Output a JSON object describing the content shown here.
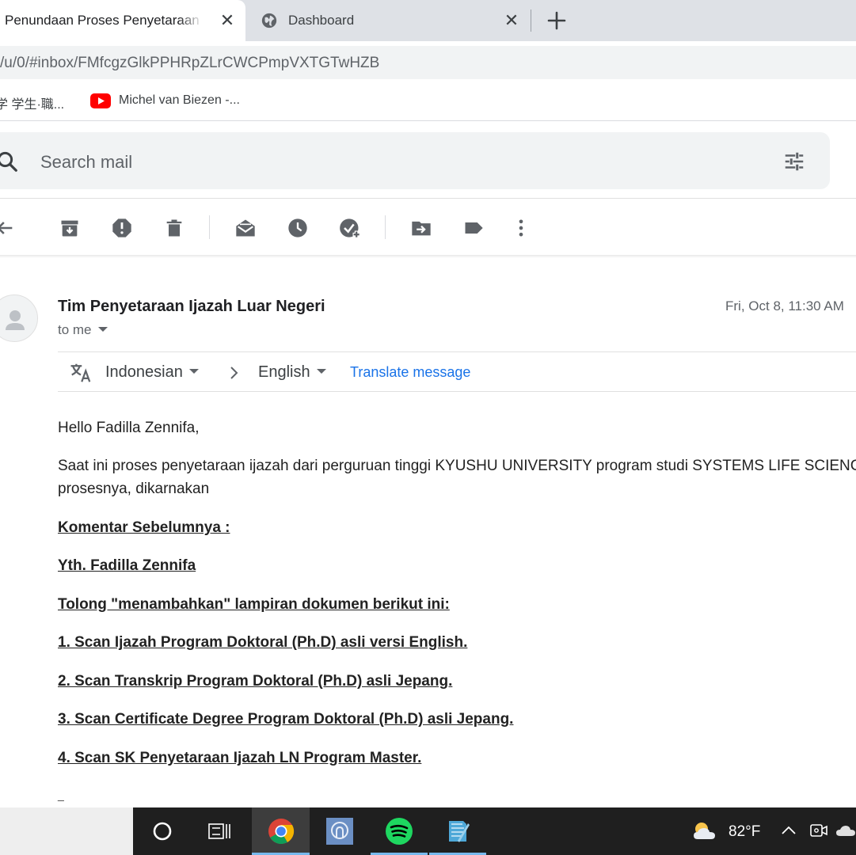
{
  "browser": {
    "tabs": [
      {
        "title": "Penundaan Proses Penyetaraan Ijazah Luar Negeri",
        "active": true
      },
      {
        "title": "Dashboard",
        "active": false
      }
    ],
    "url": "/u/0/#inbox/FMfcgzGlkPPHRpZLrCWCPmpVXTGTwHZB",
    "bookmarks": [
      {
        "label": "学 学生·職..."
      },
      {
        "label": "Michel van Biezen -..."
      }
    ]
  },
  "gmail": {
    "search_placeholder": "Search mail",
    "toolbar_icons": [
      "back-arrow-icon",
      "archive-icon",
      "report-spam-icon",
      "delete-icon",
      "mark-unread-icon",
      "snooze-icon",
      "add-task-icon",
      "move-to-icon",
      "label-icon",
      "more-vert-icon"
    ]
  },
  "message": {
    "sender": "Tim Penyetaraan Ijazah Luar Negeri",
    "date": "Fri, Oct 8, 11:30 AM",
    "to": "to me",
    "translate": {
      "from": "Indonesian",
      "to": "English",
      "link": "Translate message"
    },
    "greeting": "Hello Fadilla Zennifa,",
    "paragraph_line1": "Saat ini proses penyetaraan ijazah dari perguruan tinggi KYUSHU UNIVERSITY program studi SYSTEMS LIFE SCIENCES",
    "paragraph_line2": "prosesnya, dikarnakan",
    "comments": [
      "Komentar Sebelumnya :",
      "Yth. Fadilla Zennifa",
      "Tolong \"menambahkan\" lampiran dokumen berikut ini:",
      "1. Scan Ijazah Program Doktoral (Ph.D) asli versi English.",
      "2. Scan Transkrip Program Doktoral (Ph.D) asli Jepang.",
      "3. Scan Certificate Degree Program Doktoral (Ph.D) asli Jepang.",
      "4. Scan SK Penyetaraan Ijazah LN Program Master."
    ],
    "trailing": "_"
  },
  "taskbar": {
    "temperature": "82°F"
  }
}
